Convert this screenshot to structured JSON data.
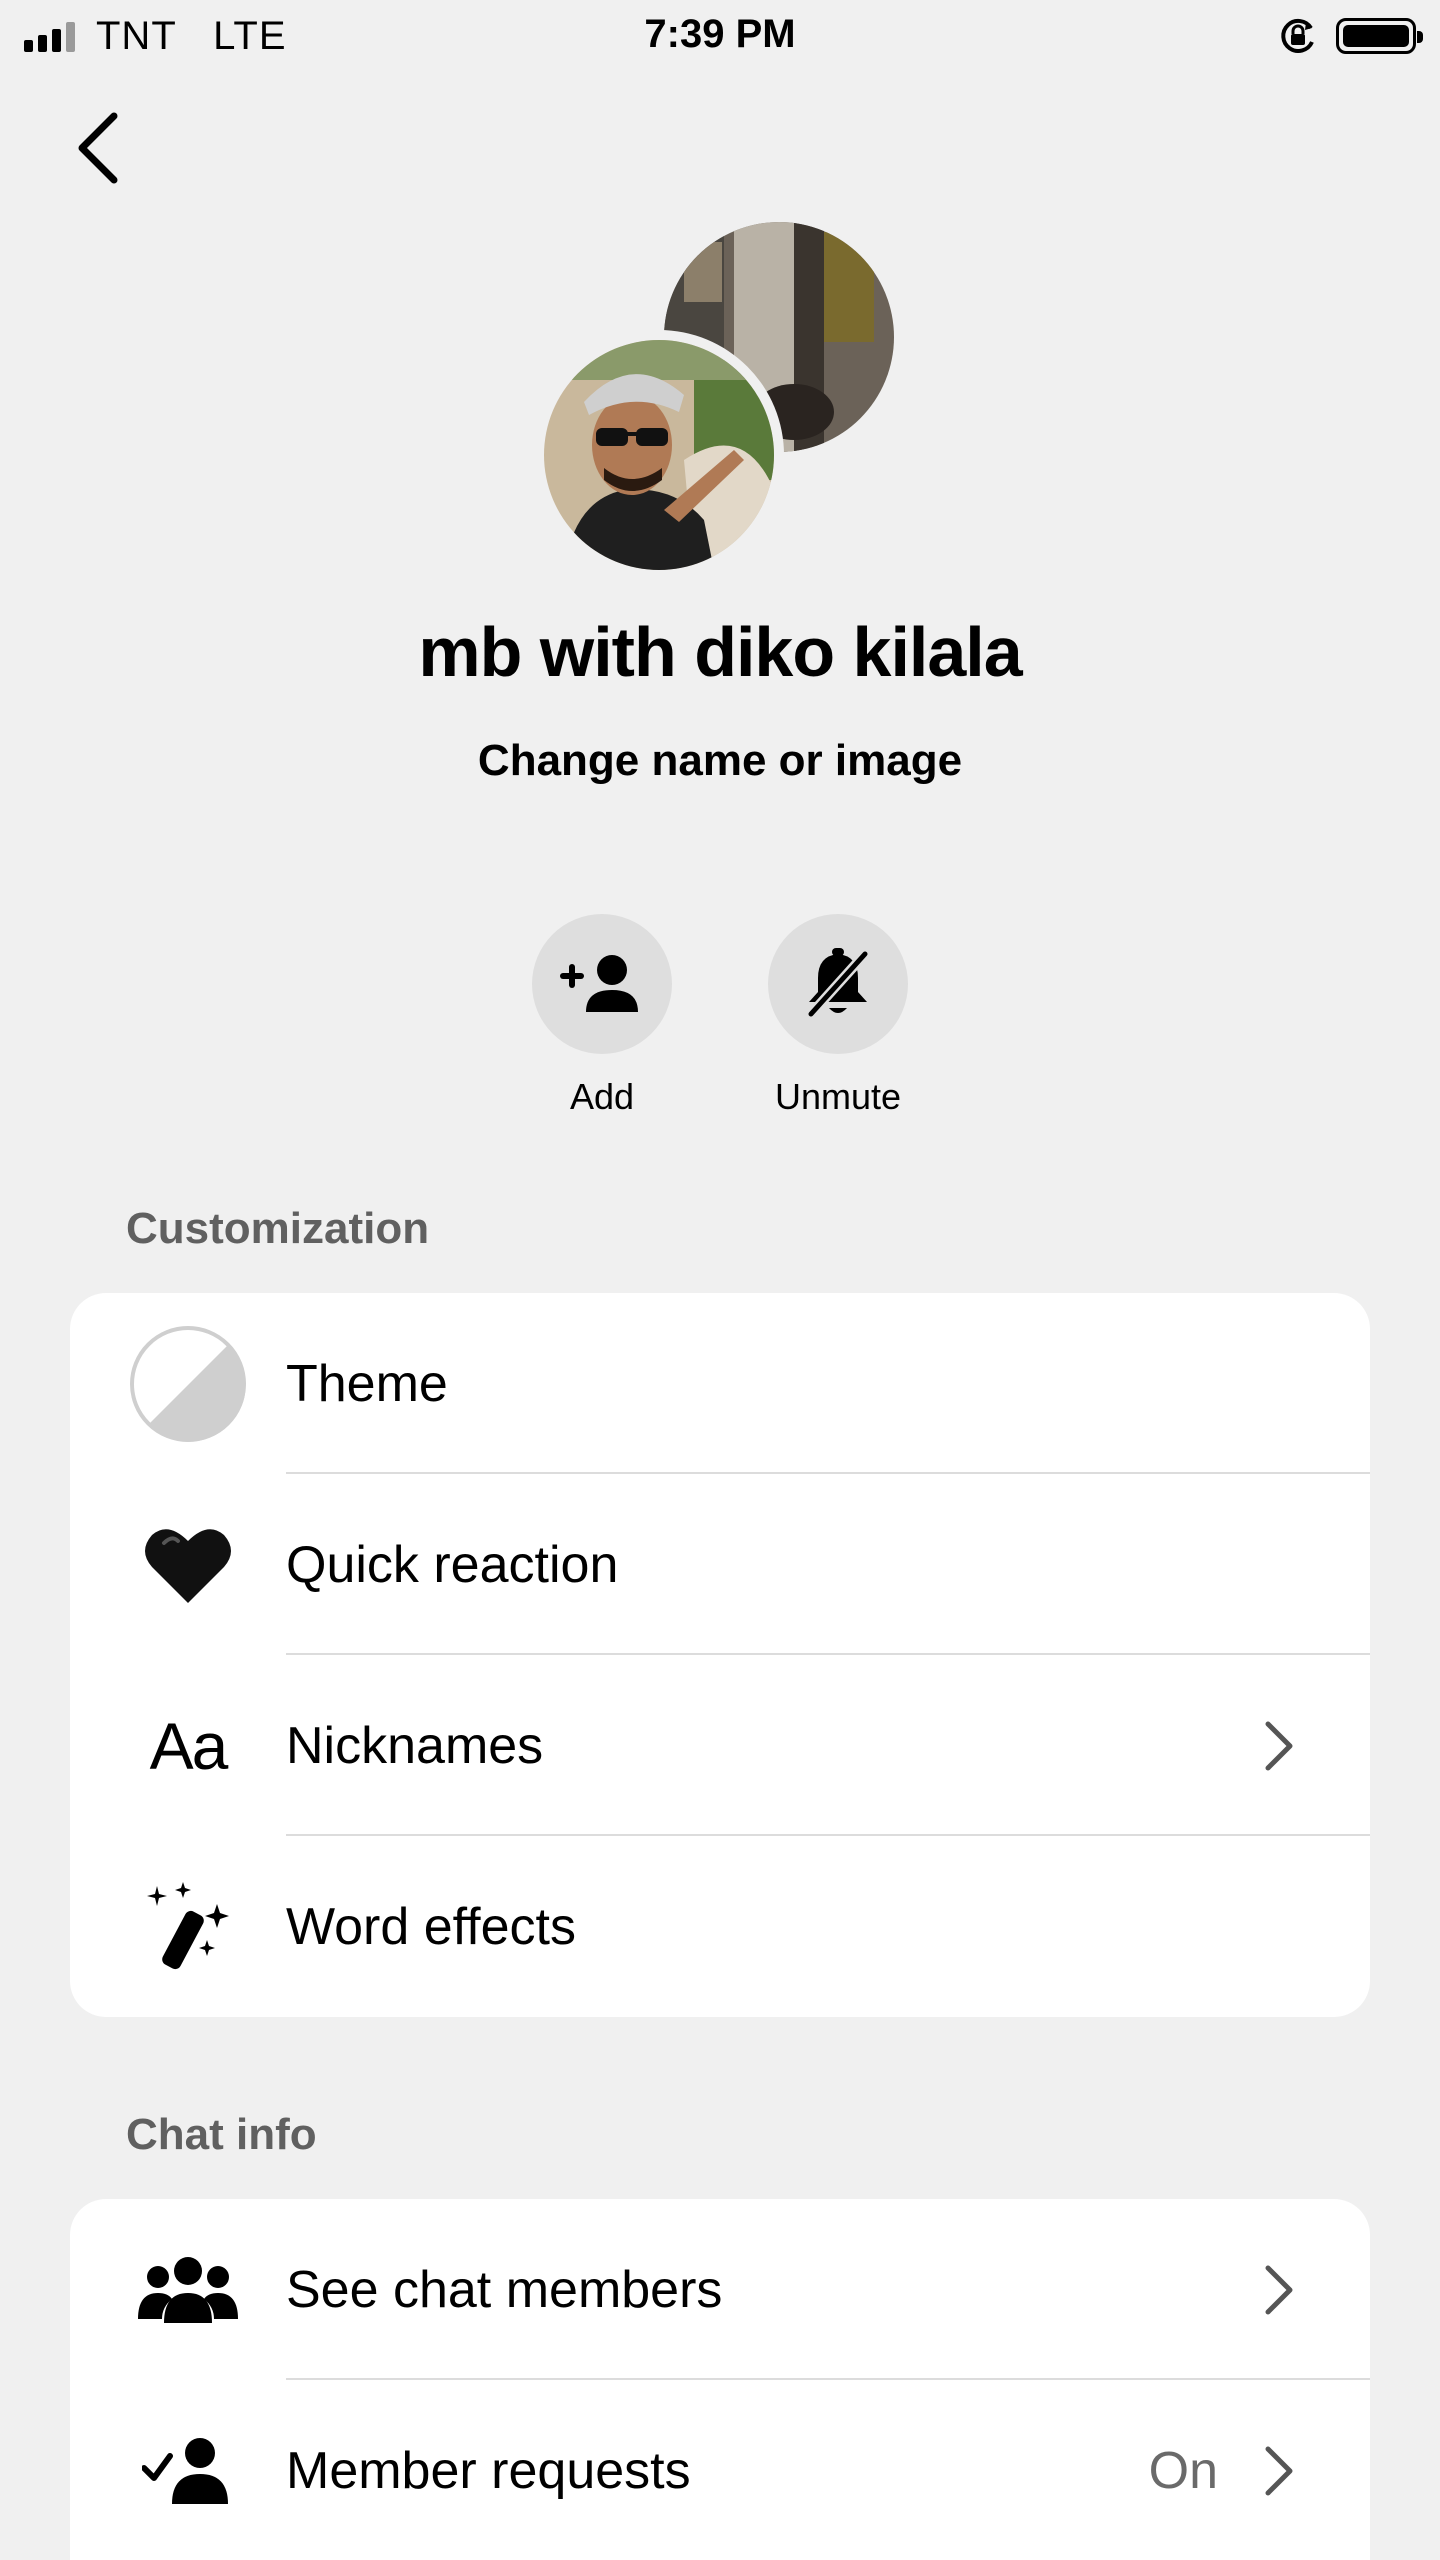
{
  "status_bar": {
    "carrier": "TNT",
    "network": "LTE",
    "time": "7:39 PM"
  },
  "header": {
    "group_name": "mb with diko kilala",
    "change_link": "Change name or image"
  },
  "actions": [
    {
      "label": "Add",
      "icon": "add-person-icon"
    },
    {
      "label": "Unmute",
      "icon": "bell-muted-icon"
    }
  ],
  "customization": {
    "title": "Customization",
    "items": [
      {
        "label": "Theme",
        "icon": "theme-icon"
      },
      {
        "label": "Quick reaction",
        "icon": "black-heart-icon"
      },
      {
        "label": "Nicknames",
        "icon_text": "Aa",
        "icon": "text-aa-icon"
      },
      {
        "label": "Word effects",
        "icon": "magic-wand-icon"
      }
    ]
  },
  "chat_info": {
    "title": "Chat info",
    "items": [
      {
        "label": "See chat members",
        "icon": "group-icon"
      },
      {
        "label": "Member requests",
        "value": "On",
        "icon": "member-approval-icon"
      }
    ]
  },
  "colors": {
    "background": "#f0f0f0",
    "card": "#ffffff",
    "section_title": "#606060",
    "action_circle": "#dedede",
    "divider": "#dcdcdc"
  }
}
